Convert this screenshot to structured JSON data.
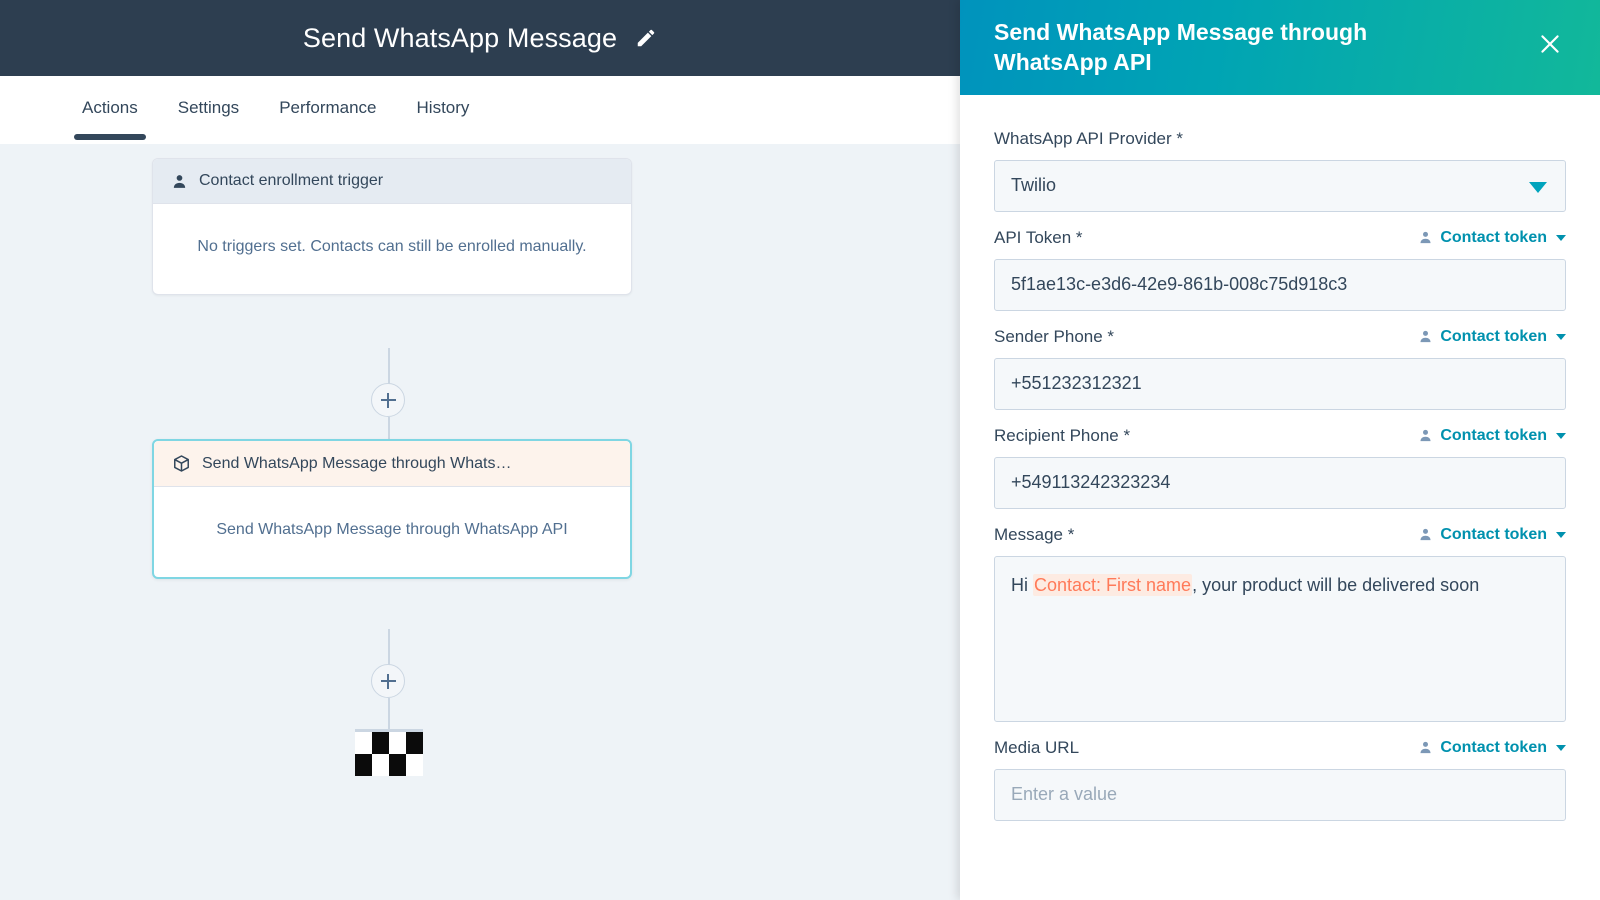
{
  "workflow": {
    "title": "Send WhatsApp Message",
    "edit_icon": "pencil-icon",
    "tabs": [
      {
        "label": "Actions",
        "active": true
      },
      {
        "label": "Settings",
        "active": false
      },
      {
        "label": "Performance",
        "active": false
      },
      {
        "label": "History",
        "active": false
      }
    ],
    "nodes": [
      {
        "icon": "contact-person-icon",
        "header": "Contact enrollment trigger",
        "body": "No triggers set. Contacts can still be enrolled manually."
      },
      {
        "icon": "cube-package-icon",
        "header": "Send WhatsApp Message through Whats…",
        "body": "Send WhatsApp Message through WhatsApp API"
      }
    ],
    "add_button_label": "+",
    "end_marker": "checkered-flag"
  },
  "panel": {
    "title": "Send WhatsApp Message through WhatsApp API",
    "close_label": "✕",
    "token_button_label": "Contact token",
    "fields": [
      {
        "label": "WhatsApp API Provider *",
        "type": "select",
        "value": "Twilio",
        "has_token": false
      },
      {
        "label": "API Token *",
        "type": "input",
        "value": "5f1ae13c-e3d6-42e9-861b-008c75d918c3",
        "has_token": true
      },
      {
        "label": "Sender Phone *",
        "type": "input",
        "value": "+551232312321",
        "has_token": true
      },
      {
        "label": "Recipient Phone *",
        "type": "input",
        "value": "+549113242323234",
        "has_token": true
      },
      {
        "label": "Message *",
        "type": "textarea",
        "value_prefix": "Hi ",
        "value_token": "Contact: First name",
        "value_suffix": ", your product will be delivered soon",
        "has_token": true
      },
      {
        "label": "Media URL",
        "type": "input",
        "value": "",
        "placeholder": "Enter a value",
        "has_token": true
      }
    ]
  },
  "colors": {
    "topbar": "#2d3e50",
    "canvas": "#eef3f7",
    "panel_gradient_start": "#0093bd",
    "panel_gradient_end": "#12b89a",
    "accent_teal": "#00a4bd",
    "token_orange": "#ff7a59",
    "selected_border": "#7fd6e3"
  }
}
